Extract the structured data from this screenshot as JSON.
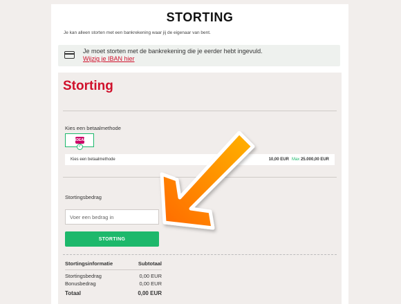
{
  "header": {
    "title": "STORTING",
    "notice": "Je kan alleen storten met een bankrekening waar jij de eigenaar van bent."
  },
  "info_box": {
    "text": "Je moet storten met de bankrekening die je eerder hebt ingevuld.",
    "link": "Wijzig je IBAN hier"
  },
  "panel": {
    "title": "Storting",
    "method_label": "Kies een betaalmethode",
    "method_icon": "iDEAL",
    "method_row": {
      "label": "Kies een betaalmethode",
      "min": "10,00 EUR",
      "max_label": "Max",
      "max": "25.000,00 EUR"
    },
    "amount_label": "Stortingsbedrag",
    "amount_placeholder": "Voer een bedrag in",
    "submit": "STORTING"
  },
  "summary": {
    "col1": "Stortingsinformatie",
    "col2": "Subtotaal",
    "rows": [
      {
        "label": "Stortingsbedrag",
        "value": "0,00 EUR"
      },
      {
        "label": "Bonusbedrag",
        "value": "0,00 EUR"
      }
    ],
    "total_label": "Totaal",
    "total_value": "0,00 EUR"
  },
  "colors": {
    "accent_red": "#d0102b",
    "accent_green": "#1db86b",
    "arrow_orange": "#ff8a00"
  }
}
